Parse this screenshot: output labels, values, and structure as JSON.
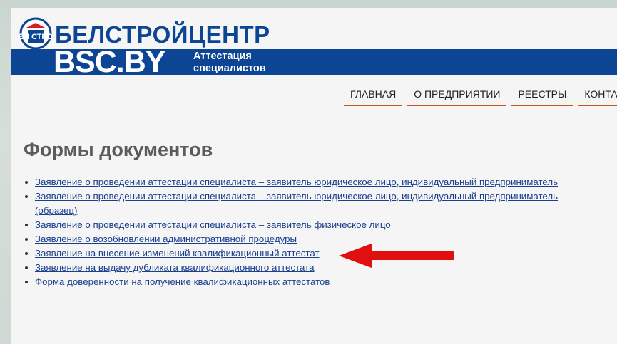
{
  "site": {
    "brand_ru": "БЕЛСТРОЙЦЕНТР",
    "brand_en": "BSC.BY",
    "tagline_line1": "Аттестация",
    "tagline_line2": "специалистов",
    "badge_text": "БЕЛ СТРОЙ"
  },
  "nav": {
    "items": [
      "ГЛАВНАЯ",
      "О ПРЕДПРИЯТИИ",
      "РЕЕСТРЫ",
      "КОНТАКТ"
    ]
  },
  "page": {
    "title": "Формы документов"
  },
  "forms": [
    {
      "label": "Заявление о проведении аттестации специалиста – заявитель юридическое лицо, индивидуальный предприниматель"
    },
    {
      "label": "Заявление о проведении аттестации специалиста – заявитель юридическое лицо, индивидуальный предприниматель (образец)"
    },
    {
      "label": "Заявление о проведении аттестации специалиста – заявитель физическое лицо"
    },
    {
      "label": "Заявление о возобновлении административной процедуры"
    },
    {
      "label": "Заявление на внесение изменений квалификационный аттестат"
    },
    {
      "label": "Заявление на выдачу дубликата квалификационного аттестата"
    },
    {
      "label": "Форма доверенности на получение квалификационных аттестатов"
    }
  ],
  "colors": {
    "brand_blue": "#0d4595",
    "nav_underline": "#c2571a",
    "link": "#1a3f8f",
    "annotation_arrow": "#e01010"
  },
  "icons": {
    "logo": "bsc-logo-badge-icon",
    "annotation": "red-arrow-left-icon"
  }
}
